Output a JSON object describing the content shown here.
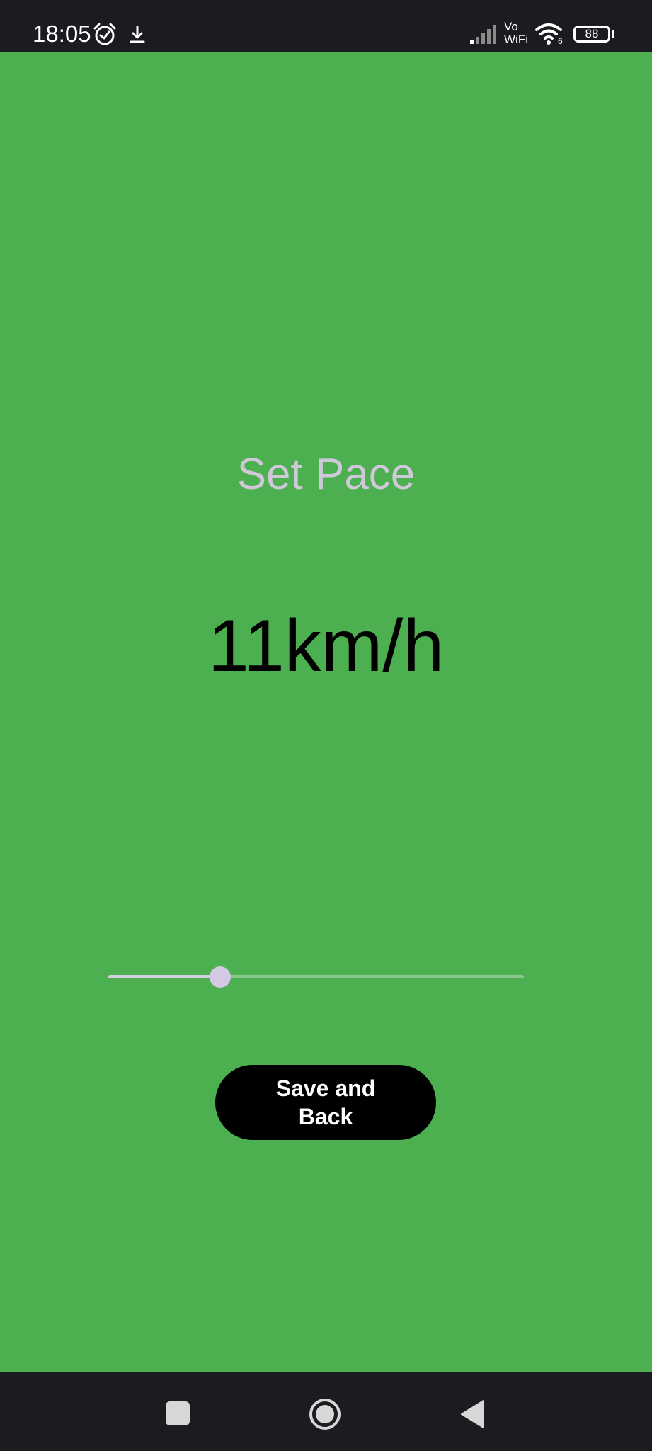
{
  "status_bar": {
    "time": "18:05",
    "vowifi_top": "Vo",
    "vowifi_bottom": "WiFi",
    "wifi_badge": "6",
    "battery_level": "88",
    "icons": [
      "alarm-icon",
      "download-icon",
      "signal-icon",
      "vowifi-icon",
      "wifi-icon",
      "battery-icon"
    ]
  },
  "screen": {
    "title": "Set Pace",
    "value_display": "11km/h",
    "background_color": "#4caf50"
  },
  "slider": {
    "fraction": 0.27
  },
  "save_button": {
    "label": "Save and Back"
  },
  "nav_bar": {
    "icons": [
      "recents-icon",
      "home-icon",
      "back-icon"
    ]
  }
}
